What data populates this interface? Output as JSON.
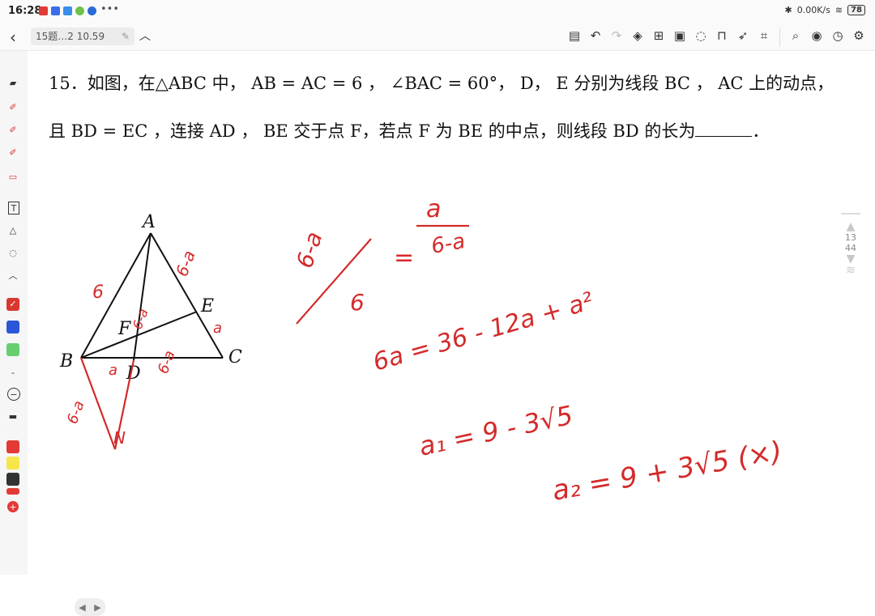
{
  "status_bar": {
    "time": "16:28",
    "net_speed": "0.00K/s",
    "battery": "78"
  },
  "title_bar": {
    "doc_title": "15题…2 10.59"
  },
  "question": {
    "number": "15．",
    "line1": "如图，在△ABC 中， AB = AC = 6 ， ∠BAC = 60°， D， E 分别为线段 BC ， AC 上的动点，",
    "line2_before": "且 BD = EC ，连接 AD ， BE 交于点 F，若点 F 为 BE 的中点，则线段 BD 的长为",
    "line2_after": "．"
  },
  "figure": {
    "point_labels": [
      "A",
      "E",
      "F",
      "B",
      "D",
      "C",
      "N"
    ],
    "side_notes": [
      "6",
      "6-a",
      "a",
      "6-a",
      "a",
      "6-a",
      "6-a"
    ]
  },
  "handwritten": {
    "frac_left_num": "6-a",
    "frac_left_den": "6",
    "equals": "=",
    "frac_right_num": "a",
    "frac_right_den": "6-a",
    "line2": "6a = 36 - 12a + a²",
    "line3": "a₁ = 9 - 3√5",
    "line4": "a₂ = 9 + 3√5 (×)"
  },
  "pager": {
    "current": "13",
    "total": "44"
  },
  "colors": {
    "ink_red": "#d42a2a",
    "swatches": [
      "#d9382f",
      "#2b56d8",
      "#67cf6f",
      "#e23a35",
      "#f6e64a",
      "#333333"
    ]
  }
}
